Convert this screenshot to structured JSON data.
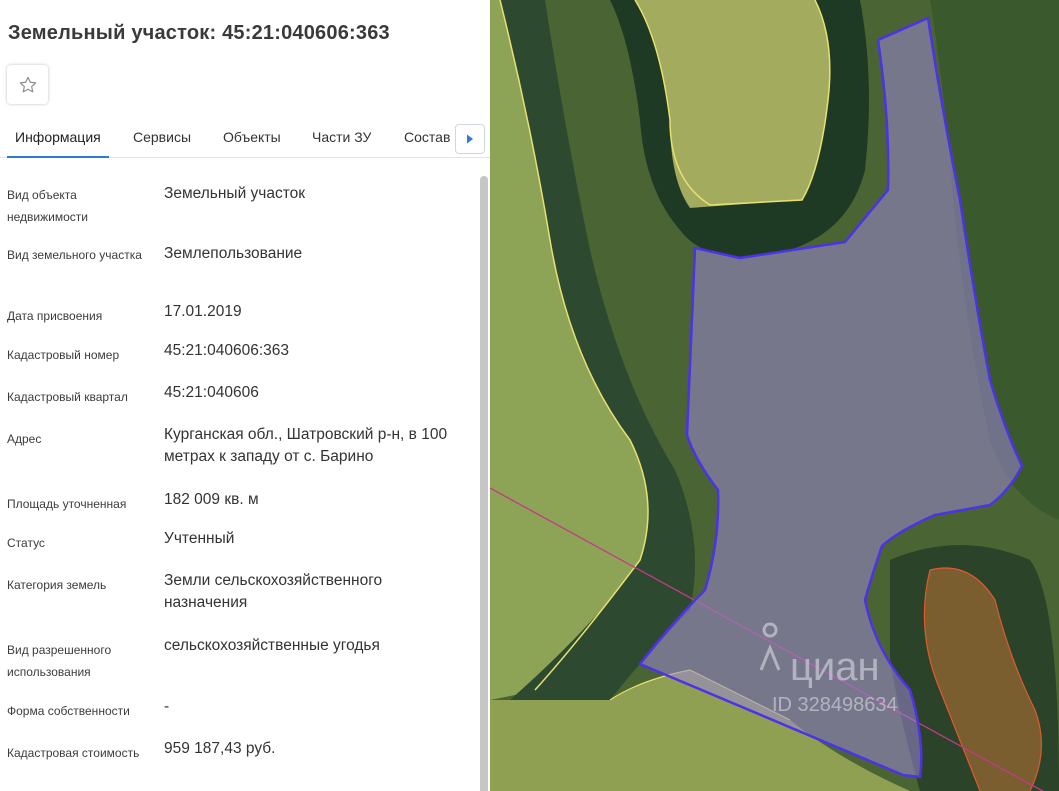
{
  "title": "Земельный участок: 45:21:040606:363",
  "colors": {
    "accent": "#2d7bd4",
    "parcel_fill": "#9b87d4",
    "parcel_border": "#4a33e8",
    "neighbor_border": "#e8e070"
  },
  "icons": {
    "favorite": "star-outline-icon",
    "tabs_next": "caret-right-icon"
  },
  "tabs": [
    {
      "label": "Информация",
      "active": true
    },
    {
      "label": "Сервисы",
      "active": false
    },
    {
      "label": "Объекты",
      "active": false
    },
    {
      "label": "Части ЗУ",
      "active": false
    },
    {
      "label": "Состав",
      "active": false
    }
  ],
  "fields": [
    {
      "label": "Вид объекта недвижимости",
      "value": "Земельный участок"
    },
    {
      "label": "Вид земельного участка",
      "value": "Землепользование"
    },
    {
      "label": "Дата присвоения",
      "value": "17.01.2019"
    },
    {
      "label": "Кадастровый номер",
      "value": "45:21:040606:363"
    },
    {
      "label": "Кадастровый квартал",
      "value": "45:21:040606"
    },
    {
      "label": "Адрес",
      "value": "Курганская обл., Шатровский р-н, в 100 метрах к западу от с. Барино"
    },
    {
      "label": "Площадь уточненная",
      "value": "182 009 кв. м"
    },
    {
      "label": "Статус",
      "value": "Учтенный"
    },
    {
      "label": "Категория земель",
      "value": "Земли сельскохозяйственного назначения"
    },
    {
      "label": "Вид разрешенного использования",
      "value": "сельскохозяйственные угодья"
    },
    {
      "label": "Форма собственности",
      "value": "-"
    },
    {
      "label": "Кадастровая стоимость",
      "value": "959 187,43 руб."
    }
  ],
  "watermark": {
    "brand": "циан",
    "id_text": "ID 328498634"
  }
}
